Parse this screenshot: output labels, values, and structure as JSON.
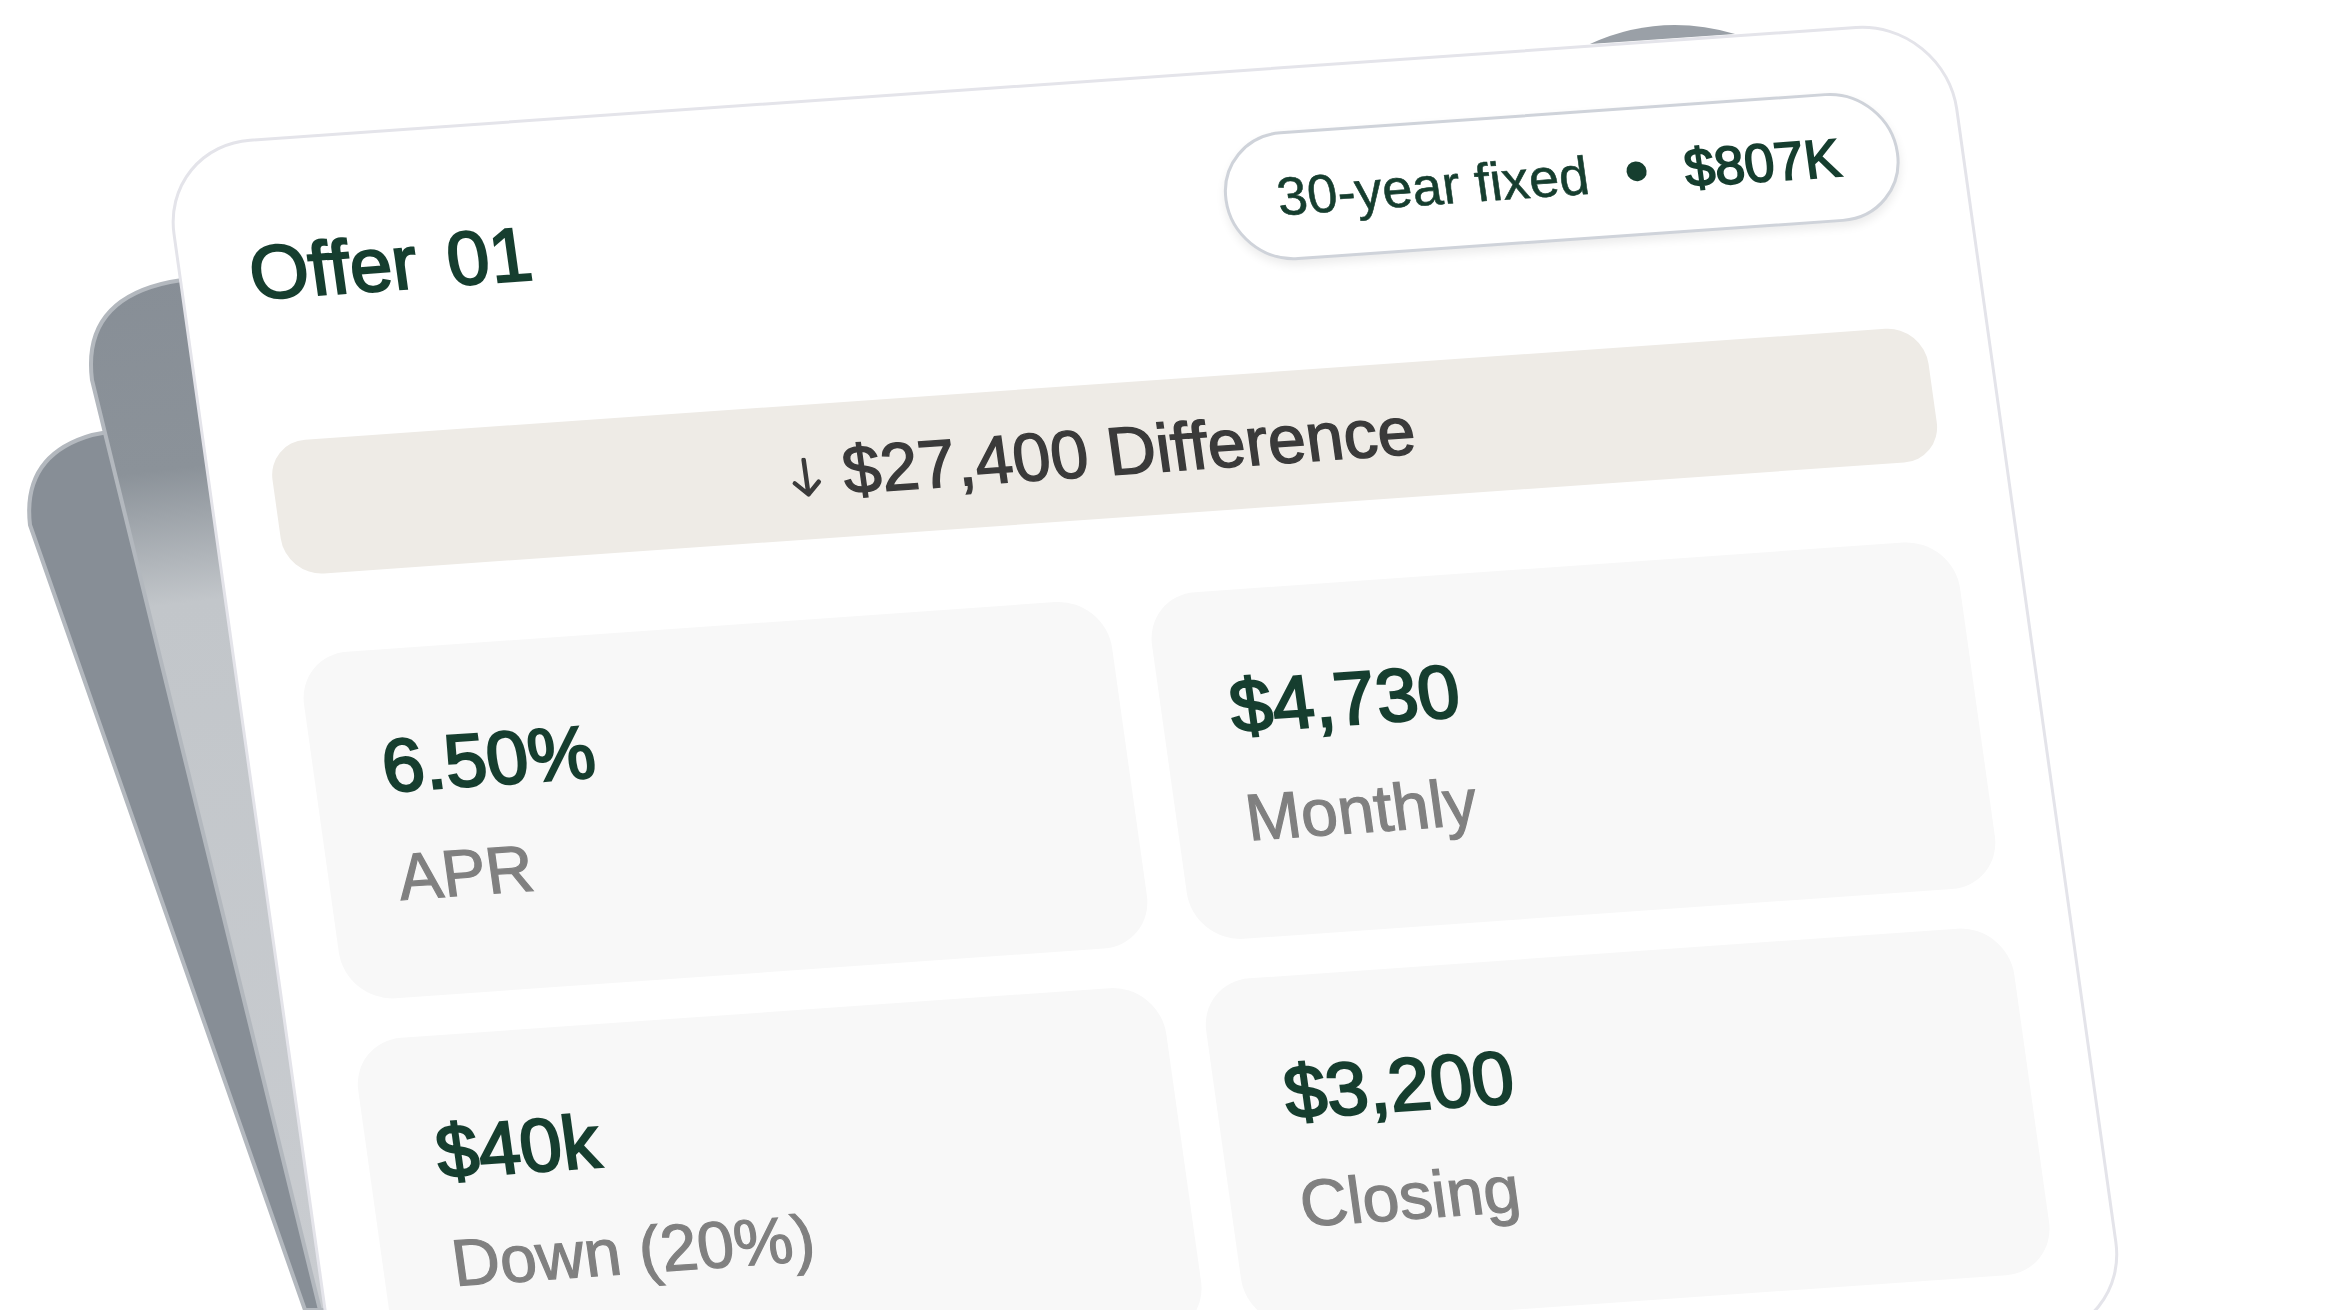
{
  "offer": {
    "title": "Offer 01",
    "loan_type": "30-year fixed",
    "amount": "$807K"
  },
  "difference": {
    "text": "$27,400 Difference"
  },
  "metrics": [
    {
      "value": "6.50%",
      "label": "APR"
    },
    {
      "value": "$4,730",
      "label": "Monthly"
    },
    {
      "value": "$40k",
      "label": "Down (20%)"
    },
    {
      "value": "$3,200",
      "label": "Closing"
    }
  ]
}
